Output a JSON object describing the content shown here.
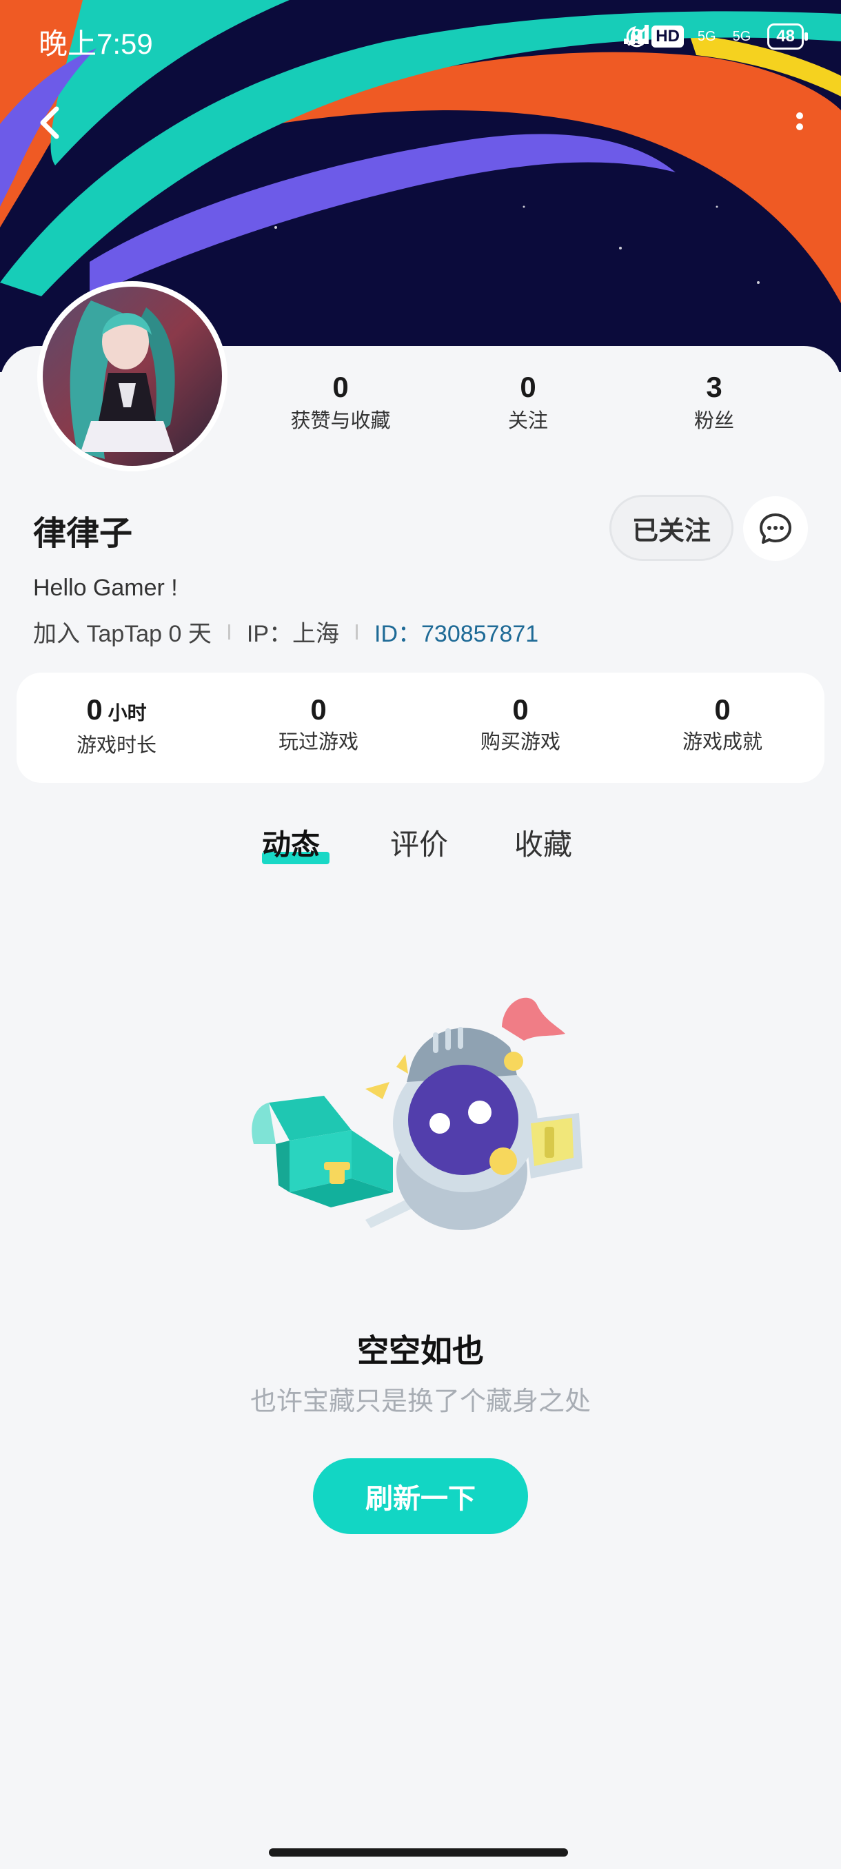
{
  "status_bar": {
    "time": "晚上7:59",
    "hd": "HD",
    "network1": "5G",
    "network2": "5G",
    "battery": "48",
    "icons": [
      "moon-icon",
      "bell-mute-icon",
      "signal-icon",
      "signal-icon",
      "battery-icon"
    ]
  },
  "nav": {
    "back_icon": "chevron-left-icon",
    "more_icon": "more-vertical-icon"
  },
  "profile": {
    "stats": [
      {
        "value": "0",
        "label": "获赞与收藏"
      },
      {
        "value": "0",
        "label": "关注"
      },
      {
        "value": "3",
        "label": "粉丝"
      }
    ],
    "username": "律律子",
    "follow_label": "已关注",
    "message_icon": "chat-bubble-icon",
    "bio": "Hello Gamer !",
    "joined": "加入 TapTap 0 天",
    "ip": "IP：上海",
    "id": "ID：730857871"
  },
  "game_stats": [
    {
      "value": "0",
      "unit": "小时",
      "label": "游戏时长"
    },
    {
      "value": "0",
      "unit": "",
      "label": "玩过游戏"
    },
    {
      "value": "0",
      "unit": "",
      "label": "购买游戏"
    },
    {
      "value": "0",
      "unit": "",
      "label": "游戏成就"
    }
  ],
  "tabs": [
    {
      "label": "动态",
      "active": true
    },
    {
      "label": "评价",
      "active": false
    },
    {
      "label": "收藏",
      "active": false
    }
  ],
  "empty_state": {
    "title": "空空如也",
    "subtitle": "也许宝藏只是换了个藏身之处",
    "button": "刷新一下"
  },
  "colors": {
    "accent": "#12d6c4",
    "banner_bg": "#0b0b3b",
    "id_link": "#1e6a96"
  }
}
